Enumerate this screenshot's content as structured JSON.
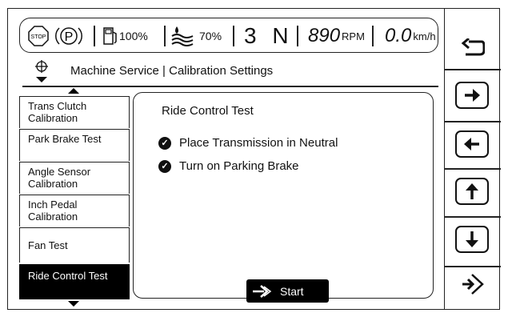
{
  "status_bar": {
    "stop_label": "STOP",
    "parking_label": "P",
    "fuel_pct": "100%",
    "def_pct": "70%",
    "gear": "3 N",
    "rpm_value": "890",
    "rpm_unit": "RPM",
    "speed_value": "0.0",
    "speed_unit": "km/h"
  },
  "header": {
    "breadcrumb": "Machine Service | Calibration Settings"
  },
  "sidebar": {
    "items": [
      {
        "label": "Trans Clutch Calibration"
      },
      {
        "label": "Park Brake Test"
      },
      {
        "label": "Angle Sensor Calibration"
      },
      {
        "label": "Inch Pedal Calibration"
      },
      {
        "label": "Fan Test"
      },
      {
        "label": "Ride Control Test"
      }
    ]
  },
  "main": {
    "title": "Ride Control Test",
    "steps": [
      {
        "label": "Place Transmission in Neutral"
      },
      {
        "label": "Turn on Parking Brake"
      }
    ],
    "start_label": "Start"
  },
  "right_nav": {
    "buttons": [
      "back-icon",
      "arrow-right-icon",
      "arrow-left-icon",
      "arrow-up-icon",
      "arrow-down-icon",
      "enter-icon"
    ]
  }
}
